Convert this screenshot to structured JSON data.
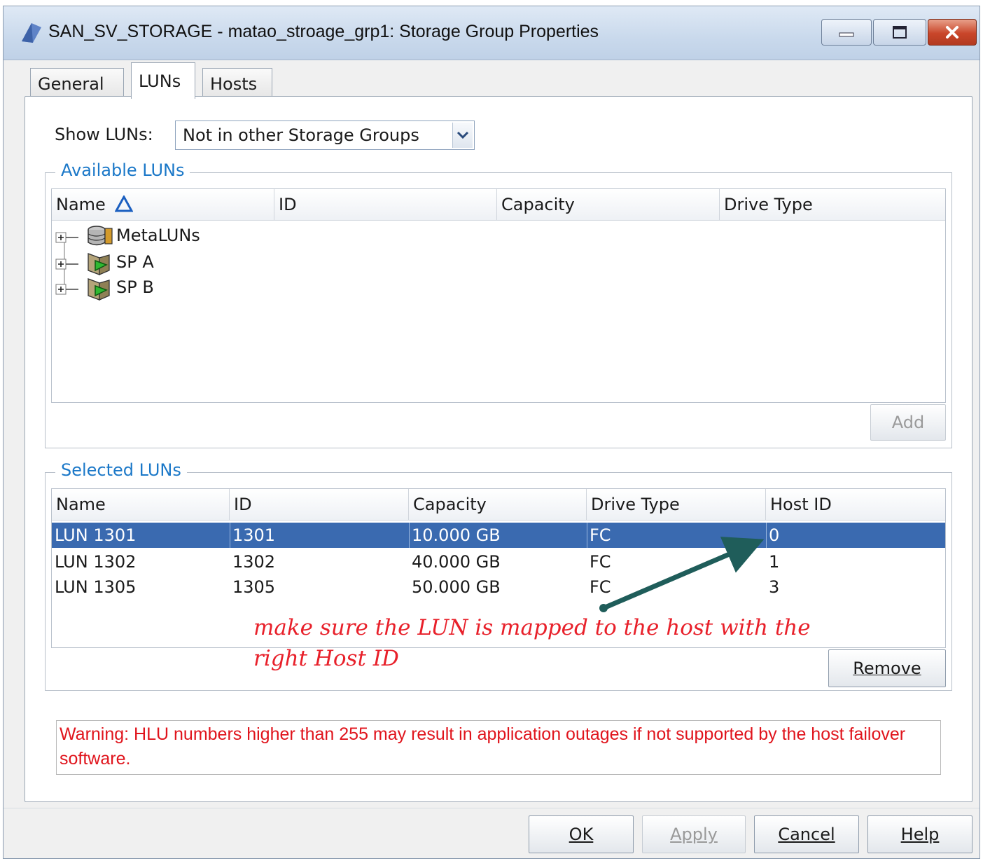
{
  "window": {
    "title": "SAN_SV_STORAGE - matao_stroage_grp1: Storage Group Properties"
  },
  "tabs": [
    {
      "label": "General"
    },
    {
      "label": "LUNs"
    },
    {
      "label": "Hosts"
    }
  ],
  "show_luns": {
    "label": "Show LUNs:",
    "value": "Not in other Storage Groups"
  },
  "available": {
    "title": "Available LUNs",
    "columns": [
      "Name",
      "ID",
      "Capacity",
      "Drive Type"
    ],
    "items": [
      {
        "label": "MetaLUNs",
        "icon": "database-icon"
      },
      {
        "label": "SP A",
        "icon": "storage-processor-icon"
      },
      {
        "label": "SP B",
        "icon": "storage-processor-icon"
      }
    ],
    "add_label": "Add"
  },
  "selected": {
    "title": "Selected LUNs",
    "columns": [
      "Name",
      "ID",
      "Capacity",
      "Drive Type",
      "Host ID"
    ],
    "rows": [
      {
        "name": "LUN 1301",
        "id": "1301",
        "capacity": "10.000 GB",
        "drive_type": "FC",
        "host_id": "0"
      },
      {
        "name": "LUN 1302",
        "id": "1302",
        "capacity": "40.000 GB",
        "drive_type": "FC",
        "host_id": "1"
      },
      {
        "name": "LUN 1305",
        "id": "1305",
        "capacity": "50.000 GB",
        "drive_type": "FC",
        "host_id": "3"
      }
    ],
    "remove_label": "Remove"
  },
  "annotation": {
    "line1": "make sure the LUN is mapped to the host with the",
    "line2": "right Host ID",
    "color": "#e8202a",
    "arrow_color": "#1f5d5a"
  },
  "warning": {
    "text": "Warning: HLU numbers higher than 255 may result in application outages if not supported by the host failover software."
  },
  "footer": {
    "ok_label": "OK",
    "apply_label": "Apply",
    "cancel_label": "Cancel",
    "help_label": "Help"
  },
  "colors": {
    "selection": "#3a6ab0",
    "group_title": "#1b78c8",
    "warning": "#e0141c"
  }
}
